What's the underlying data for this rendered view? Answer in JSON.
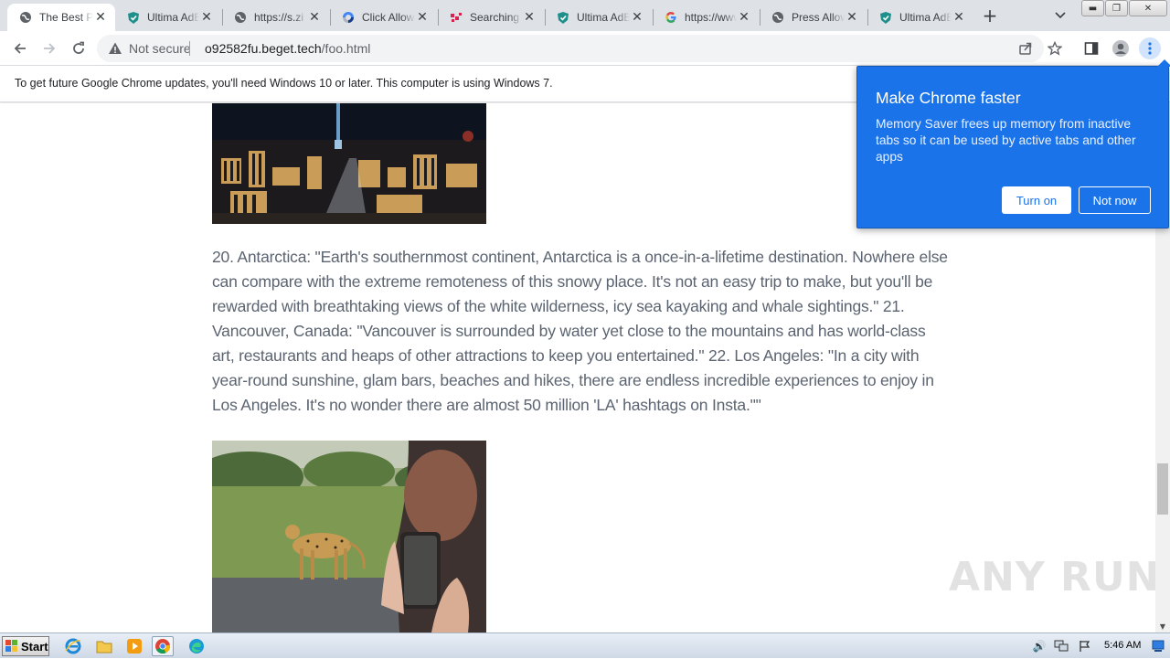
{
  "tabs": [
    {
      "label": "The Best Places",
      "icon": "globe-icon",
      "active": true
    },
    {
      "label": "Ultima AdBlock",
      "icon": "shield-icon"
    },
    {
      "label": "https://s.zi",
      "icon": "globe-icon"
    },
    {
      "label": "Click Allow",
      "icon": "recaptcha-icon"
    },
    {
      "label": "Searching for",
      "icon": "dots-icon"
    },
    {
      "label": "Ultima AdBlock",
      "icon": "shield-icon"
    },
    {
      "label": "https://www",
      "icon": "google-icon"
    },
    {
      "label": "Press Allow",
      "icon": "globe-icon"
    },
    {
      "label": "Ultima AdBlock",
      "icon": "shield-icon"
    }
  ],
  "address": {
    "security": "Not secure",
    "host": "o92582fu.beget.tech",
    "path": "/foo.html"
  },
  "infobar": {
    "message": "To get future Google Chrome updates, you'll need Windows 10 or later. This computer is using Windows 7."
  },
  "article": {
    "text": "20. Antarctica: \"Earth's southernmost continent, Antarctica is a once-in-a-lifetime destination. Nowhere else can compare with the extreme remoteness of this snowy place. It's not an easy trip to make, but you'll be rewarded with breathtaking views of the white wilderness, icy sea kayaking and whale sightings.\" 21. Vancouver, Canada: \"Vancouver is surrounded by water yet close to the mountains and has world-class art, restaurants and heaps of other attractions to keep you entertained.\" 22. Los Angeles: \"In a city with year-round sunshine, glam bars, beaches and hikes, there are endless incredible experiences to enjoy in Los Angeles. It's no wonder there are almost 50 million 'LA' hashtags on Insta.\"\""
  },
  "popup": {
    "title": "Make Chrome faster",
    "body": "Memory Saver frees up memory from inactive tabs so it can be used by active tabs and other apps",
    "turn_on": "Turn on",
    "not_now": "Not now"
  },
  "taskbar": {
    "start": "Start",
    "clock": "5:46 AM"
  },
  "watermark": "ANY RUN",
  "colors": {
    "popup_bg": "#1a73e8",
    "tabstrip_bg": "#dee1e6",
    "text_gray": "#5b6470"
  }
}
